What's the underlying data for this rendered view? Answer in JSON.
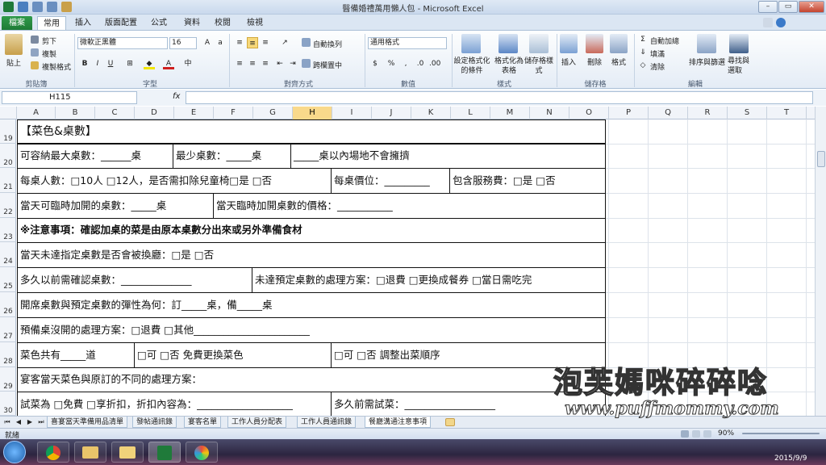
{
  "window": {
    "title": "醫備婚禮萬用懶人包 - Microsoft Excel"
  },
  "tabs": [
    "檔案",
    "常用",
    "插入",
    "版面配置",
    "公式",
    "資料",
    "校閱",
    "檢視"
  ],
  "ribbon": {
    "clipboard": {
      "paste": "貼上",
      "cut": "剪下",
      "copy": "複製",
      "format_painter": "複製格式",
      "label": "剪貼簿"
    },
    "font": {
      "name": "微軟正黑體",
      "size": "16",
      "label": "字型"
    },
    "alignment": {
      "wrap": "自動換列",
      "merge": "跨欄置中",
      "label": "對齊方式"
    },
    "number": {
      "format": "通用格式",
      "label": "數值"
    },
    "styles": {
      "conditional": "設定格式化的條件",
      "as_table": "格式化為表格",
      "cell_styles": "儲存格樣式",
      "label": "樣式"
    },
    "cells": {
      "insert": "插入",
      "delete": "刪除",
      "format": "格式",
      "label": "儲存格"
    },
    "editing": {
      "autosum": "自動加總",
      "fill": "填滿",
      "clear": "清除",
      "sort": "排序與篩選",
      "find": "尋找與選取",
      "label": "編輯"
    }
  },
  "formula_bar": {
    "name_box": "H115",
    "fx": "fx",
    "formula": ""
  },
  "columns": [
    "A",
    "B",
    "C",
    "D",
    "E",
    "F",
    "G",
    "H",
    "I",
    "J",
    "K",
    "L",
    "M",
    "N",
    "O",
    "P",
    "Q",
    "R",
    "S",
    "T"
  ],
  "selected_column": "H",
  "rows": [
    "19",
    "20",
    "21",
    "22",
    "23",
    "24",
    "25",
    "26",
    "27",
    "28",
    "29",
    "30"
  ],
  "cells": {
    "r19": "【菜色&桌數】",
    "r20a": "可容納最大桌數：______桌",
    "r20b": "最少桌數：_____桌",
    "r20c": "_____桌以內場地不會擁擠",
    "r21a": "每桌人數：□10人 □12人，是否需扣除兒童椅□是 □否",
    "r21b": "每桌價位：_________",
    "r21c": "包含服務費：□是 □否",
    "r22a": "當天可臨時加開的桌數：_____桌",
    "r22b": "當天臨時加開桌數的價格：___________",
    "r23": "※注意事項：確認加桌的菜是由原本桌數分出來或另外準備食材",
    "r24": "當天未達指定桌數是否會被換廳：□是 □否",
    "r25a": "多久以前需確認桌數：______________",
    "r25b": "未達預定桌數的處理方案：□退費 □更換成餐券 □當日需吃完",
    "r26": "開席桌數與預定桌數的彈性為何：訂_____桌，備_____桌",
    "r27": "預備桌沒開的處理方案：□退費 □其他_______________________",
    "r28a": "菜色共有_____道",
    "r28b": "□可 □否 免費更換菜色",
    "r28c": "□可 □否 調整出菜順序",
    "r29": "宴客當天菜色與原訂的不同的處理方案：",
    "r30a": "試菜為 □免費 □享折扣，折扣內容為：___________________",
    "r30b": "多久前需試菜：__________________"
  },
  "sheet_tabs": [
    "喜宴當天準備用品清單",
    "發帖通訊錄",
    "宴客名單",
    "工作人員分配表",
    "工作人員通訊錄",
    "餐廳溝通注意事項"
  ],
  "active_sheet_index": 5,
  "status": {
    "left": "就緒",
    "zoom": "90%"
  },
  "taskbar": {
    "date": "2015/9/9"
  },
  "watermark": {
    "line1": "泡芙媽咪碎碎唸",
    "line2": "www.puffmommy.com"
  }
}
